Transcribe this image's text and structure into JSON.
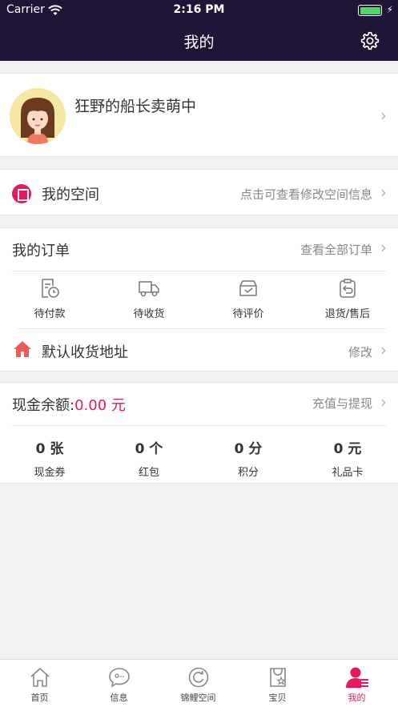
{
  "status_bar": {
    "carrier": "Carrier",
    "time": "2:16 PM"
  },
  "nav": {
    "title": "我的"
  },
  "profile": {
    "username": "狂野的船长卖萌中"
  },
  "space": {
    "label": "我的空间",
    "hint": "点击可查看修改空间信息"
  },
  "orders": {
    "title": "我的订单",
    "view_all": "查看全部订单",
    "items": [
      {
        "label": "待付款",
        "icon": "bill-clock-icon"
      },
      {
        "label": "待收货",
        "icon": "truck-icon"
      },
      {
        "label": "待评价",
        "icon": "review-box-icon"
      },
      {
        "label": "退货/售后",
        "icon": "return-icon"
      }
    ],
    "address_label": "默认收货地址",
    "address_action": "修改"
  },
  "wallet": {
    "balance_label": "现金余额:",
    "balance_value": "0.00 元",
    "action": "充值与提现",
    "stats": [
      {
        "value": "0 张",
        "label": "现金券"
      },
      {
        "value": "0 个",
        "label": "红包"
      },
      {
        "value": "0 分",
        "label": "积分"
      },
      {
        "value": "0 元",
        "label": "礼品卡"
      }
    ]
  },
  "tabbar": {
    "items": [
      {
        "label": "首页",
        "icon": "home-icon"
      },
      {
        "label": "信息",
        "icon": "chat-icon"
      },
      {
        "label": "锦鲤空间",
        "icon": "refresh-circle-icon"
      },
      {
        "label": "宝贝",
        "icon": "bag-star-icon"
      },
      {
        "label": "我的",
        "icon": "user-icon"
      }
    ],
    "active_index": 4
  },
  "colors": {
    "nav_bg": "#1f1536",
    "accent": "#e8185c",
    "battery": "#4cd964"
  }
}
